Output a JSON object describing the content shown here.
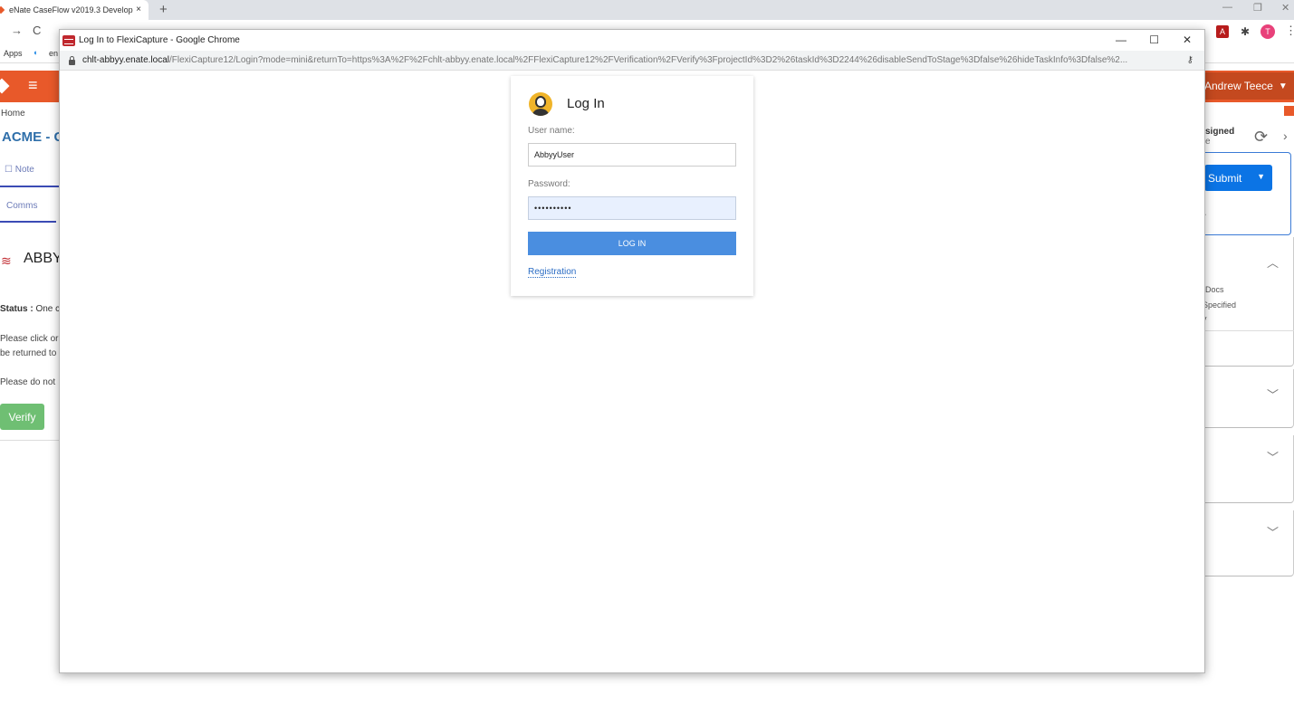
{
  "browser": {
    "tab_title": "eNate CaseFlow v2019.3 Develop",
    "tab_close": "×",
    "new_tab": "+",
    "bookmarks_apps": "Apps",
    "bookmark_1": "en",
    "window_min": "—",
    "window_restore": "❐",
    "window_close": "✕"
  },
  "app": {
    "user_name": "Andrew Teece",
    "breadcrumb": "Home",
    "case_title": "ACME - G",
    "note_tab": "Note",
    "comms_tab": "Comms",
    "abbyy_heading": "ABBY",
    "status_label": "Status :",
    "status_value": "One c",
    "para1_line1": "Please click or",
    "para1_line2": "be returned to",
    "para2": "Please do not",
    "verify_label": "Verify",
    "assigned_line1": "signed",
    "assigned_line2": "e",
    "submit_label": "Submit",
    "side_docs": "Docs",
    "side_specified": "Specified",
    "side_y": "y"
  },
  "popup": {
    "window_title": "Log In to FlexiCapture - Google Chrome",
    "url_host": "chlt-abbyy.enate.local",
    "url_rest": "/FlexiCapture12/Login?mode=mini&returnTo=https%3A%2F%2Fchlt-abbyy.enate.local%2FFlexiCapture12%2FVerification%2FVerify%3FprojectId%3D2%26taskId%3D2244%26disableSendToStage%3Dfalse%26hideTaskInfo%3Dfalse%2...",
    "ctrl_min": "—",
    "ctrl_max": "☐",
    "ctrl_close": "✕"
  },
  "login": {
    "title": "Log In",
    "username_label": "User name:",
    "username_value": "AbbyyUser",
    "password_label": "Password:",
    "password_value": "••••••••••",
    "login_button": "LOG IN",
    "registration_link": "Registration"
  },
  "colors": {
    "app_header": "#e8592a",
    "login_button": "#4a8ee0",
    "submit_button": "#0b74e5",
    "verify_button": "#6fbf73"
  }
}
